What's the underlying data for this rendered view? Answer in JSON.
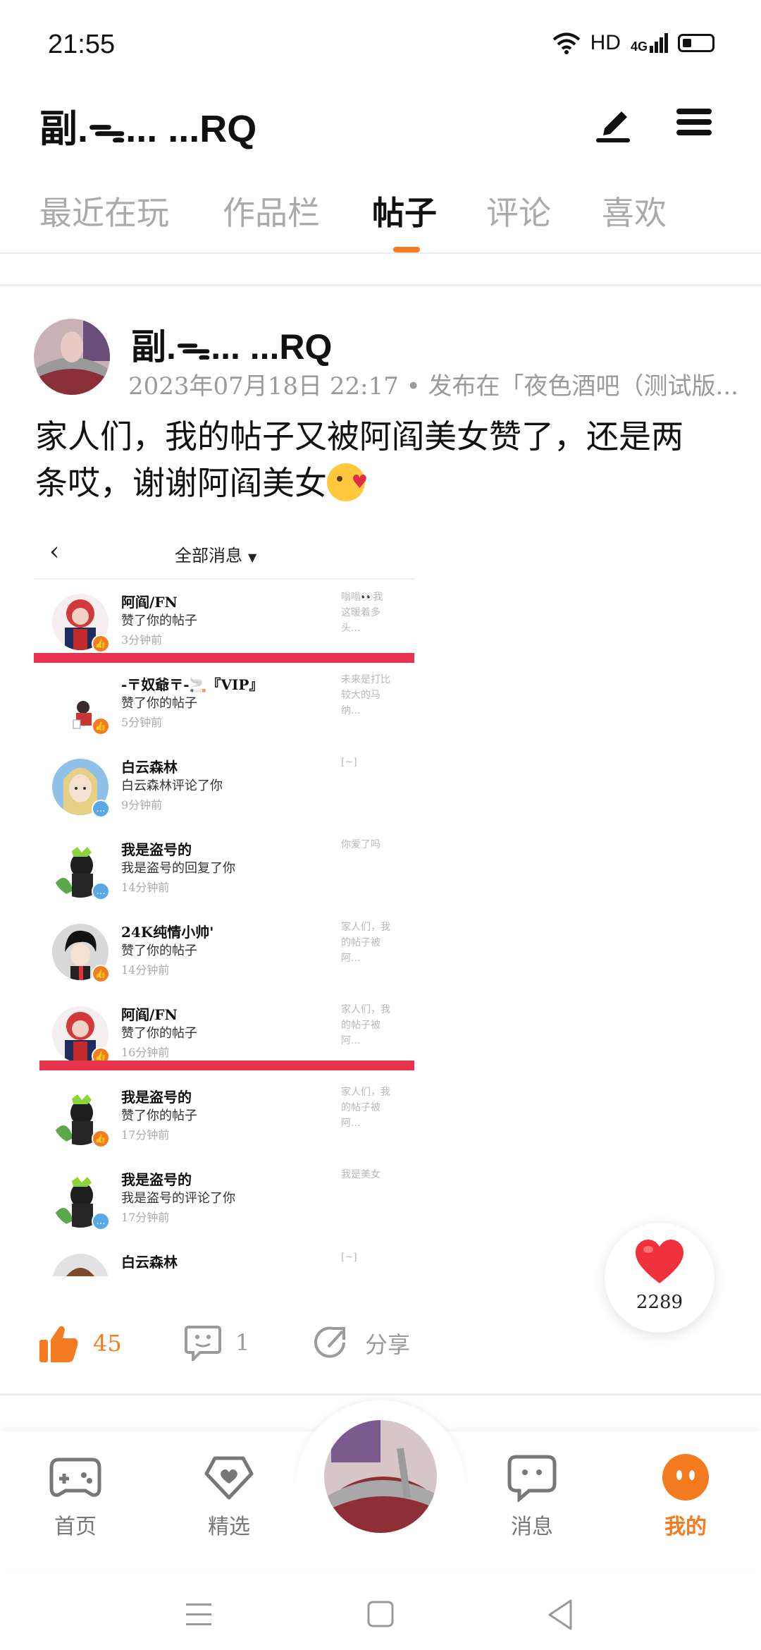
{
  "status_bar": {
    "time": "21:55",
    "network": "HD",
    "cellular": "4G"
  },
  "header": {
    "user_name": "副.ᯓ... ...RQ"
  },
  "tabs": [
    {
      "label": "最近在玩"
    },
    {
      "label": "作品栏"
    },
    {
      "label": "帖子"
    },
    {
      "label": "评论"
    },
    {
      "label": "喜欢"
    }
  ],
  "active_tab": "帖子",
  "post": {
    "author": "副.ᯓ... ...RQ",
    "meta": "2023年07月18日 22:17 • 发布在「夜色酒吧（测试版...",
    "text": "家人们，我的帖子又被阿阎美女赞了，还是两条哎，谢谢阿阎美女",
    "screenshot": {
      "back": "‹",
      "title": "全部消息",
      "messages": [
        {
          "name": "阿阎/FN",
          "action": "赞了你的帖子",
          "time": "3分钟前",
          "preview": "嗡嗡👀我这暖着多头...",
          "badge": "like",
          "avatar": "red"
        },
        {
          "name": "-〒奴爺〒-🚬『VIP』",
          "action": "赞了你的帖子",
          "time": "5分钟前",
          "preview": "未来是打比较大的马纳...",
          "badge": "like",
          "avatar": "small"
        },
        {
          "name": "白云森林",
          "action": "白云森林评论了你",
          "time": "9分钟前",
          "preview": "[~]",
          "badge": "comment",
          "avatar": "blonde"
        },
        {
          "name": "我是盗号的",
          "action": "我是盗号的回复了你",
          "time": "14分钟前",
          "preview": "你爱了吗",
          "badge": "comment",
          "avatar": "green"
        },
        {
          "name": "24K纯情小帅'",
          "action": "赞了你的帖子",
          "time": "14分钟前",
          "preview": "家人们，我的帖子被阿...",
          "badge": "like",
          "avatar": "black"
        },
        {
          "name": "阿阎/FN",
          "action": "赞了你的帖子",
          "time": "16分钟前",
          "preview": "家人们，我的帖子被阿...",
          "badge": "like",
          "avatar": "red"
        },
        {
          "name": "我是盗号的",
          "action": "赞了你的帖子",
          "time": "17分钟前",
          "preview": "家人们，我的帖子被阿...",
          "badge": "like",
          "avatar": "green"
        },
        {
          "name": "我是盗号的",
          "action": "我是盗号的评论了你",
          "time": "17分钟前",
          "preview": "我是美女",
          "badge": "comment",
          "avatar": "green"
        },
        {
          "name": "白云森林",
          "action": "",
          "time": "",
          "preview": "[~]",
          "badge": "none",
          "avatar": "brown"
        }
      ]
    },
    "likes": "45",
    "comments": "1",
    "share_label": "分享"
  },
  "heart_count": "2289",
  "bottom_nav": [
    {
      "label": "首页",
      "icon": "gamepad-icon"
    },
    {
      "label": "精选",
      "icon": "heart-diamond-icon"
    },
    {
      "label": "消息",
      "icon": "chat-icon"
    },
    {
      "label": "我的",
      "icon": "profile-face-icon"
    }
  ],
  "colors": {
    "accent": "#f47b20",
    "highlight": "#e8334f",
    "heart": "#f0303c"
  }
}
